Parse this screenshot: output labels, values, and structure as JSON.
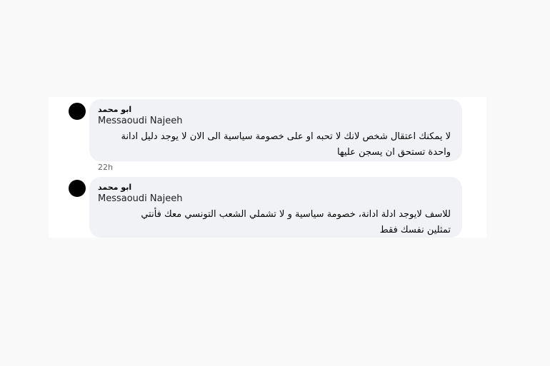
{
  "comments": [
    {
      "author_ar": "ابو محمد",
      "author_en": "Messaoudi Najeeh",
      "text": "لا يمكنك اعتقال شخص لانك لا تحبه او على خصومة سياسية الى الان لا يوجد دليل ادانة واحدة تستحق ان يسجن عليها",
      "time": "22h"
    },
    {
      "author_ar": "ابو محمد",
      "author_en": "Messaoudi Najeeh",
      "text": "للاسف لايوجد ادلة ادانة، خصومة سياسية و لا تشملي الشعب التونسي معك فأنتي تمثلين نفسك فقط"
    }
  ]
}
